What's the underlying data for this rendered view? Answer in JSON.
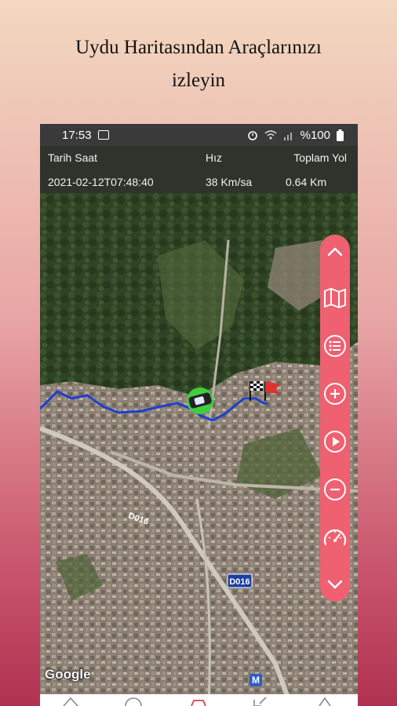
{
  "headline": {
    "line1": "Uydu Haritasından Araçlarınızı",
    "line2": "izleyin"
  },
  "status_bar": {
    "time": "17:53",
    "battery": "%100",
    "icons": [
      "image-icon",
      "alarm-icon",
      "wifi-icon",
      "signal-icon",
      "battery-icon"
    ]
  },
  "info": {
    "date_label": "Tarih Saat",
    "speed_label": "Hız",
    "distance_label": "Toplam Yol",
    "date_value": "2021-02-12T07:48:40",
    "speed_value": "38 Km/sa",
    "distance_value": "0.64 Km"
  },
  "map": {
    "provider": "Google",
    "road_labels": [
      "D016",
      "D016"
    ],
    "metro_label": "M",
    "route_color": "#1f3fd0",
    "vehicle_color": "#3ecf3e"
  },
  "controls": {
    "color": "#ef6070",
    "buttons": [
      "chevron-up-icon",
      "map-icon",
      "list-icon",
      "zoom-in-icon",
      "play-icon",
      "zoom-out-icon",
      "speedometer-icon",
      "chevron-down-icon"
    ]
  }
}
